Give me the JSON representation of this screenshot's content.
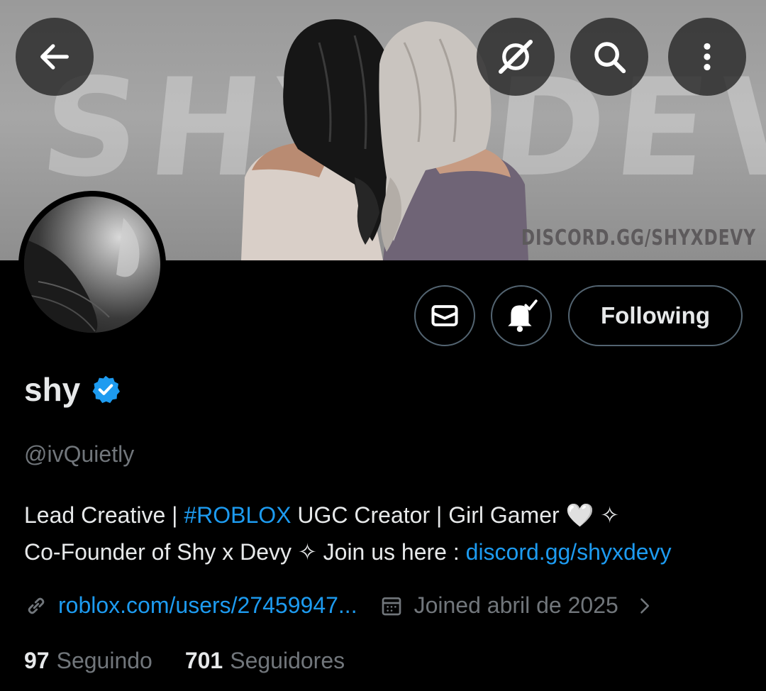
{
  "header": {
    "banner_background_text": "SHYXDEVY",
    "banner_watermark": "DISCORD.GG/SHYXDEVY",
    "back_icon": "arrow-left-icon",
    "grok_icon": "grok-icon",
    "search_icon": "search-icon",
    "more_icon": "more-vertical-icon"
  },
  "actions": {
    "message_icon": "envelope-icon",
    "notifications_icon": "bell-check-icon",
    "follow_label": "Following"
  },
  "profile": {
    "display_name": "shy",
    "verified": true,
    "handle": "@ivQuietly",
    "bio": {
      "line1_a": "Lead Creative | ",
      "line1_hashtag": "#ROBLOX",
      "line1_b": " UGC Creator | Girl Gamer 🤍   ✧",
      "line2_a": "Co-Founder of Shy x Devy ✧ Join us here : ",
      "line2_link": "discord.gg/shyxdevy"
    },
    "website": "roblox.com/users/27459947...",
    "joined": "Joined abril de 2025"
  },
  "stats": {
    "following_count": "97",
    "following_label": "Seguindo",
    "followers_count": "701",
    "followers_label": "Seguidores"
  },
  "colors": {
    "accent": "#1d9bf0",
    "muted": "#71767b",
    "text": "#e7e9ea",
    "border": "#536471"
  }
}
